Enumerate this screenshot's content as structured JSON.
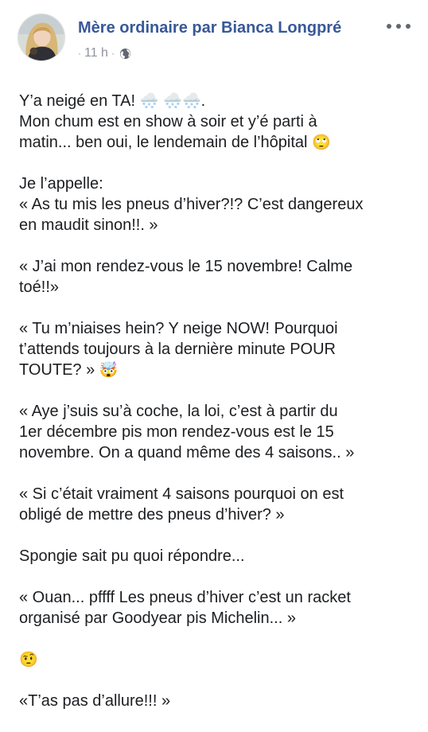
{
  "post": {
    "author": "Mère ordinaire par Bianca Longpré",
    "time_dot": "·",
    "time": "11 h",
    "time_sep": "·",
    "more_icon": "more-options-icon",
    "privacy_icon": "globe-icon",
    "paragraphs": [
      {
        "l1_text": "Y’a neigé en TA! ",
        "l1_emojis": "🌨️ 🌨️🌨️",
        "l1_end": ".",
        "l2": "Mon chum est en show à soir et y’é parti à",
        "l3_text": "matin... ben oui, le lendemain de l’hôpital ",
        "l3_emoji": "🙄"
      },
      {
        "l1": "Je l’appelle:",
        "l2": "« As tu mis les pneus d’hiver?!? C’est dangereux",
        "l3": "en maudit sinon!!. »"
      },
      {
        "l1": "« J’ai mon rendez-vous le 15 novembre! Calme",
        "l2": "toé!!»"
      },
      {
        "l1": "« Tu m’niaises hein? Y neige NOW! Pourquoi",
        "l2": "t’attends toujours à la dernière minute POUR",
        "l3_text": "TOUTE? » ",
        "l3_emoji": "🤯"
      },
      {
        "l1": "« Aye j’suis su’à coche, la loi, c’est à partir du",
        "l2": "1er décembre pis mon rendez-vous est le 15",
        "l3": "novembre. On a quand même des 4 saisons.. »"
      },
      {
        "l1": "« Si c’était vraiment 4 saisons pourquoi on est",
        "l2": "obligé de mettre des pneus d’hiver? »"
      },
      {
        "l1": "Spongie sait pu quoi répondre..."
      },
      {
        "l1": "« Ouan... pffff Les pneus d’hiver c’est un racket",
        "l2": "organisé par Goodyear pis Michelin... »"
      },
      {
        "emoji": "🤨"
      },
      {
        "l1": "«T’as pas d’allure!!! »"
      }
    ]
  }
}
